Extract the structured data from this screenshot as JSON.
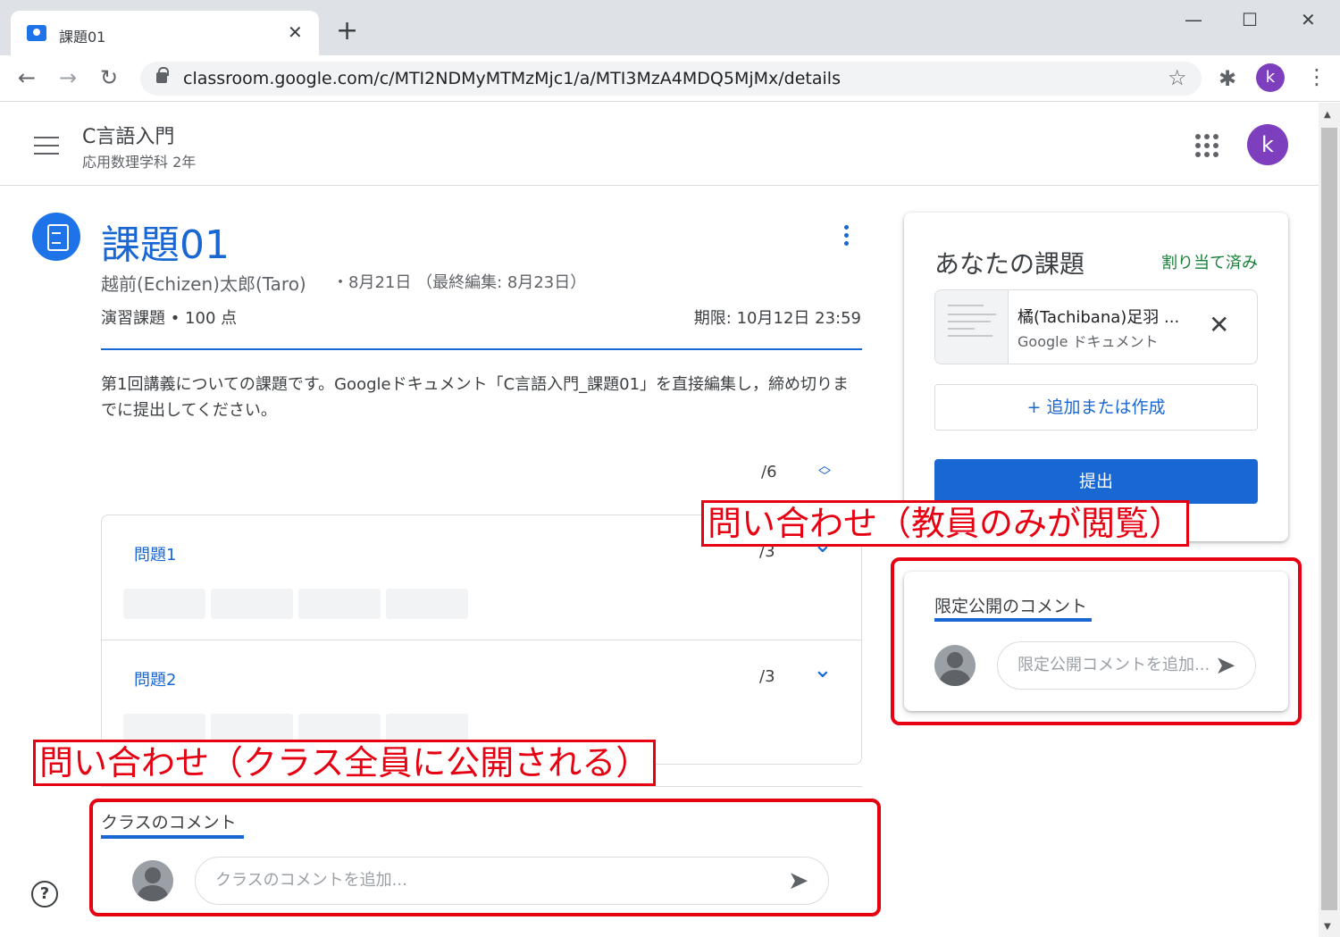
{
  "browser": {
    "tab_title": "課題01",
    "tab_close": "✕",
    "new_tab": "+",
    "win_min": "—",
    "win_max": "☐",
    "win_close": "✕",
    "back": "←",
    "forward": "→",
    "reload": "↻",
    "url": "classroom.google.com/c/MTI2NDMyMTMzMjc1/a/MTI3MzA4MDQ5MjMx/details",
    "star": "☆",
    "ext": "✱",
    "profile_initial": "k",
    "menu": "⋮"
  },
  "header": {
    "course_title": "C言語入門",
    "course_sub": "応用数理学科 2年",
    "avatar_initial": "k"
  },
  "assignment": {
    "title": "課題01",
    "author": "越前(Echizen)太郎(Taro)",
    "dates": "・8月21日 （最終編集: 8月23日）",
    "points": "演習課題 • 100 点",
    "due": "期限: 10月12日 23:59",
    "description": "第1回講義についての課題です。Googleドキュメント「C言語入門_課題01」を直接編集し，締め切りまでに提出してください。",
    "total_score": "/6",
    "rubric": [
      {
        "name": "問題1",
        "score": "/3"
      },
      {
        "name": "問題2",
        "score": "/3"
      }
    ]
  },
  "class_comments": {
    "label": "クラスのコメント",
    "placeholder": "クラスのコメントを追加..."
  },
  "your_work": {
    "title": "あなたの課題",
    "status": "割り当て済み",
    "attachment_name": "橘(Tachibana)足羽 ...",
    "attachment_type": "Google ドキュメント",
    "add_label": "+ 追加または作成",
    "submit_label": "提出"
  },
  "private_comments": {
    "label": "限定公開のコメント",
    "placeholder": "限定公開コメントを追加..."
  },
  "annotations": {
    "private_note": "問い合わせ（教員のみが閲覧）",
    "class_note": "問い合わせ（クラス全員に公開される）"
  },
  "colors": {
    "accent": "#1967d2",
    "annotation_red": "#e60012",
    "assigned_green": "#188038",
    "avatar_purple": "#7e3fbf"
  },
  "icons": {
    "send": "➤",
    "chevron_down": "⌄",
    "help": "?"
  }
}
